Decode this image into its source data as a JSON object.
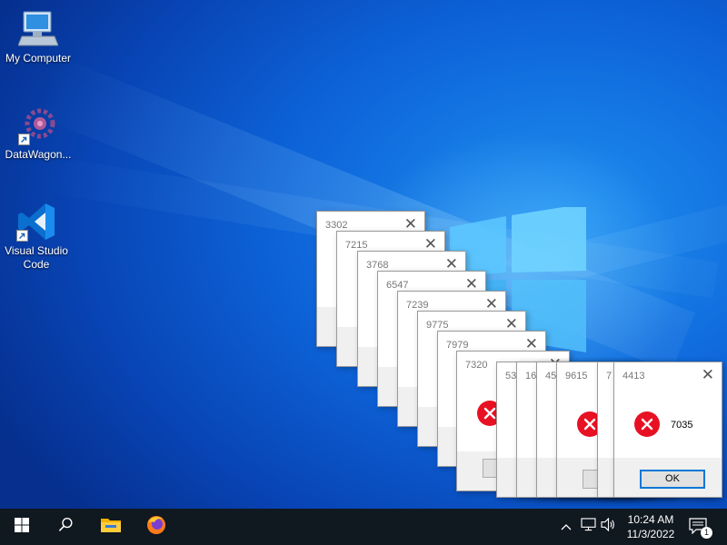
{
  "desktop": {
    "icons": [
      {
        "label": "My Computer",
        "icon": "computer-icon"
      },
      {
        "label": "DataWagon...",
        "icon": "datawagon-icon"
      },
      {
        "label": "Visual Studio Code",
        "icon": "vscode-icon"
      }
    ]
  },
  "dialogs": [
    {
      "title": "3302"
    },
    {
      "title": "7215"
    },
    {
      "title": "3768"
    },
    {
      "title": "6547"
    },
    {
      "title": "7239"
    },
    {
      "title": "9775"
    },
    {
      "title": "7979"
    },
    {
      "title": "7320"
    },
    {
      "title": "53"
    },
    {
      "title": "16"
    },
    {
      "title": "45"
    },
    {
      "title": "9615"
    },
    {
      "title": "7"
    },
    {
      "title": "4413",
      "message": "7035",
      "ok_label": "OK"
    }
  ],
  "close_glyph": "✕",
  "taskbar": {
    "pinned": [
      "start-icon",
      "search-icon",
      "file-explorer-icon",
      "firefox-icon"
    ],
    "clock_time": "10:24 AM",
    "clock_date": "11/3/2022",
    "notification_count": "1"
  },
  "colors": {
    "error_red": "#e81123",
    "taskbar": "#101820",
    "desktop_blue": "#0d63d8"
  }
}
